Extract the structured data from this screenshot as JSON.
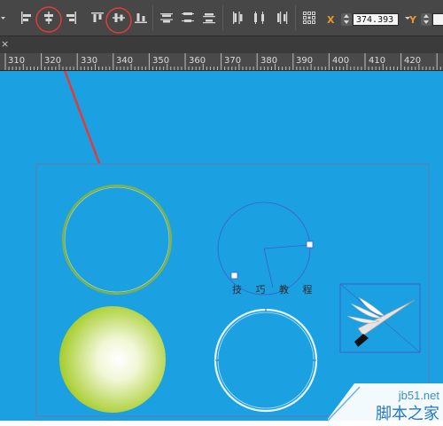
{
  "toolbar": {
    "x_label": "X",
    "x_value": "374.393",
    "y_label": "Y",
    "highlight_color": "#e33a3a",
    "icons": [
      "align-left-edges-icon",
      "align-horizontal-centers-icon",
      "align-right-edges-icon",
      "align-top-edges-icon",
      "align-vertical-centers-icon",
      "align-bottom-edges-icon",
      "distribute-top-icon",
      "distribute-vertical-centers-icon",
      "distribute-bottom-icon",
      "distribute-left-icon",
      "distribute-horizontal-centers-icon",
      "distribute-right-icon",
      "reference-point-icon"
    ]
  },
  "document_bar": {
    "close_glyph": "×"
  },
  "ruler": {
    "labels": [
      "310",
      "320",
      "330",
      "340",
      "350",
      "360",
      "370",
      "380",
      "390",
      "400",
      "410",
      "420"
    ]
  },
  "canvas": {
    "background": "#1ba1e2",
    "path_text": "技 巧 教 程"
  },
  "watermark": {
    "site": "jb51.net",
    "text": "脚本之家"
  }
}
